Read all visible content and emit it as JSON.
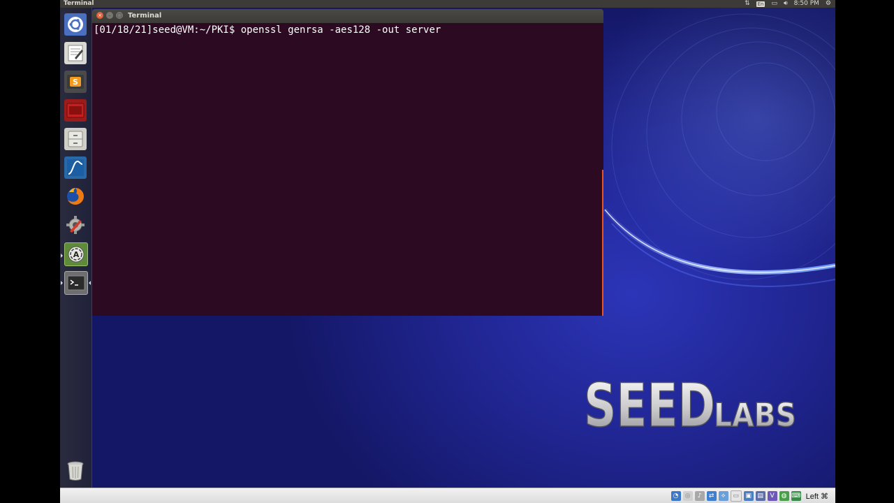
{
  "top_panel": {
    "app_name": "Terminal",
    "clock": "8:50 PM",
    "keyboard_layout": "En",
    "indicators": [
      "network-arrows-icon",
      "keyboard-layout-indicator",
      "battery-icon",
      "volume-icon",
      "clock",
      "settings-gear-icon"
    ]
  },
  "launcher": {
    "items": [
      {
        "name": "dash-home",
        "icon": "ubuntu-logo-icon"
      },
      {
        "name": "text-editor",
        "icon": "text-editor-icon"
      },
      {
        "name": "sublime-text",
        "icon": "sublime-text-icon"
      },
      {
        "name": "terminal-red",
        "icon": "terminal-red-icon"
      },
      {
        "name": "files",
        "icon": "file-cabinet-icon"
      },
      {
        "name": "wireshark",
        "icon": "wireshark-fin-icon"
      },
      {
        "name": "firefox",
        "icon": "firefox-icon"
      },
      {
        "name": "system-settings",
        "icon": "settings-wrench-icon"
      },
      {
        "name": "software-updater",
        "icon": "software-updater-icon"
      },
      {
        "name": "terminal",
        "icon": "terminal-icon"
      }
    ],
    "trash_icon": "trash-icon"
  },
  "terminal_window": {
    "title": "Terminal",
    "close_glyph": "×",
    "min_glyph": "–",
    "max_glyph": "□",
    "prompt": "[01/18/21]seed@VM:~/PKI$",
    "command": "openssl genrsa -aes128 -out server"
  },
  "desktop": {
    "logo_primary": "SEED",
    "logo_secondary": "LABS"
  },
  "vbox_statusbar": {
    "host_key": "Left ⌘",
    "icons": [
      "hard-disk-icon",
      "optical-drive-icon",
      "audio-icon",
      "network-icon",
      "usb-icon",
      "shared-folder-icon",
      "display-icon",
      "recording-icon",
      "cpu-v-icon",
      "mouse-integration-icon",
      "keyboard-icon"
    ]
  },
  "colors": {
    "terminal_bg": "#2c0a21",
    "accent_orange": "#e95420",
    "panel": "#3c3b37",
    "desktop_blue": "#1f248e"
  }
}
